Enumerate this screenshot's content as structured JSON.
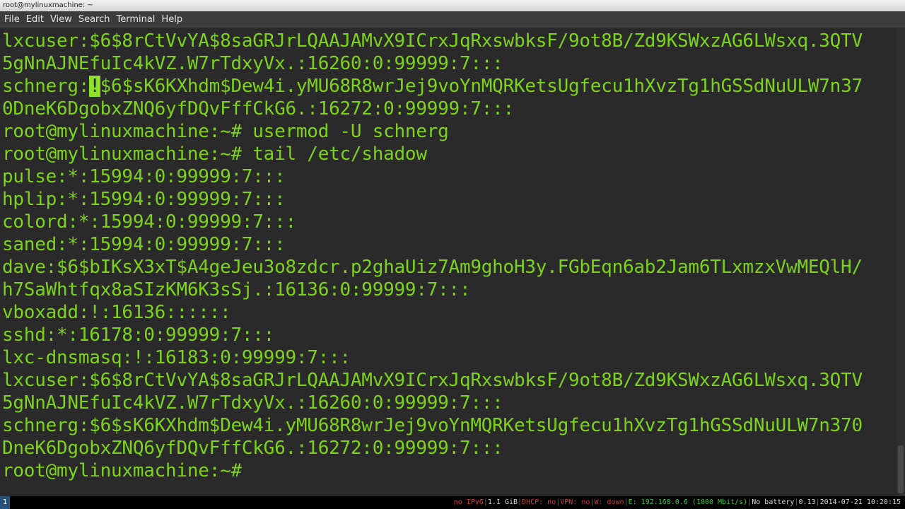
{
  "window": {
    "title": "root@mylinuxmachine: ~"
  },
  "menu": {
    "items": [
      "File",
      "Edit",
      "View",
      "Search",
      "Terminal",
      "Help"
    ]
  },
  "terminal": {
    "lines": [
      {
        "text": "lxcuser:$6$8rCtVvYA$8saGRJrLQAAJAMvX9ICrxJqRxswbksF/9ot8B/Zd9KSWxzAG6LWsxq.3QTV"
      },
      {
        "text": "5gNnAJNEfuIc4kVZ.W7rTdxyVx.:16260:0:99999:7:::"
      },
      {
        "before": "schnerg:",
        "cursor": "!",
        "after": "$6$sK6KXhdm$Dew4i.yMU68R8wrJej9voYnMQRKetsUgfecu1hXvzTg1hGSSdNuULW7n37"
      },
      {
        "text": "0DneK6DgobxZNQ6yfDQvFffCkG6.:16272:0:99999:7:::"
      },
      {
        "text": "root@mylinuxmachine:~# usermod -U schnerg"
      },
      {
        "text": "root@mylinuxmachine:~# tail /etc/shadow"
      },
      {
        "text": "pulse:*:15994:0:99999:7:::"
      },
      {
        "text": "hplip:*:15994:0:99999:7:::"
      },
      {
        "text": "colord:*:15994:0:99999:7:::"
      },
      {
        "text": "saned:*:15994:0:99999:7:::"
      },
      {
        "text": "dave:$6$bIKsX3xT$A4geJeu3o8zdcr.p2ghaUiz7Am9ghoH3y.FGbEqn6ab2Jam6TLxmzxVwMEQlH/"
      },
      {
        "text": "h7SaWhtfqx8aSIzKM6K3sSj.:16136:0:99999:7:::"
      },
      {
        "text": "vboxadd:!:16136::::::"
      },
      {
        "text": "sshd:*:16178:0:99999:7:::"
      },
      {
        "text": "lxc-dnsmasq:!:16183:0:99999:7:::"
      },
      {
        "text": "lxcuser:$6$8rCtVvYA$8saGRJrLQAAJAMvX9ICrxJqRxswbksF/9ot8B/Zd9KSWxzAG6LWsxq.3QTV"
      },
      {
        "text": "5gNnAJNEfuIc4kVZ.W7rTdxyVx.:16260:0:99999:7:::"
      },
      {
        "text": "schnerg:$6$sK6KXhdm$Dew4i.yMU68R8wrJej9voYnMQRKetsUgfecu1hXvzTg1hGSSdNuULW7n370"
      },
      {
        "text": "DneK6DgobxZNQ6yfDQvFffCkG6.:16272:0:99999:7:::"
      },
      {
        "text": "root@mylinuxmachine:~# "
      }
    ]
  },
  "statusbar": {
    "workspace": "1",
    "ipv6": "no IPv6",
    "disk": "1.1 GiB",
    "dhcp": "DHCP: no",
    "vpn": "VPN: no",
    "wireless": "W: down",
    "ethernet": "E: 192.168.0.6 (1000 Mbit/s)",
    "battery": "No battery",
    "load": "0.13",
    "datetime": "2014-07-21 10:20:15",
    "colors": {
      "red": "#d43b3b",
      "green": "#3cc74a",
      "workspace_bg": "#28527a"
    }
  },
  "colors": {
    "terminal_fg": "#7dd31c",
    "terminal_bg": "#2a2a2a",
    "cursor": "#8ee02a"
  }
}
